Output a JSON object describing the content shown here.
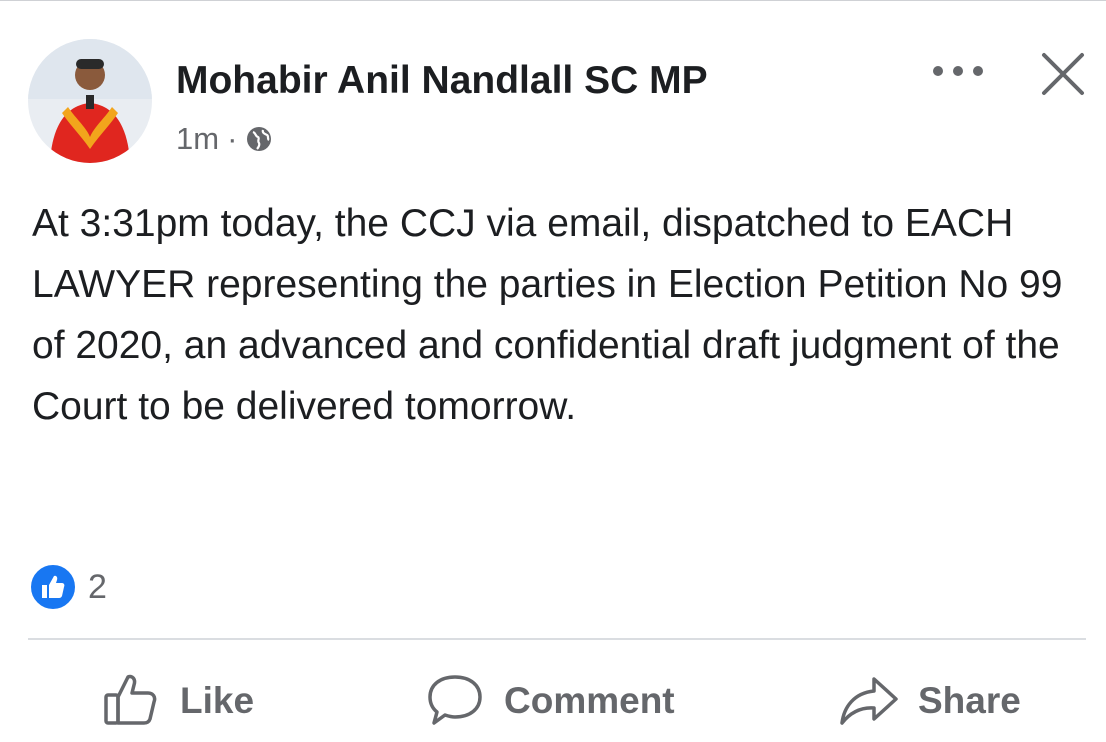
{
  "post": {
    "author": "Mohabir Anil Nandlall SC MP",
    "time": "1m",
    "separator": "·",
    "audience_icon": "globe-icon",
    "text": "At 3:31pm today, the CCJ via email, dispatched to EACH LAWYER representing the parties in Election Petition No 99 of 2020, an advanced and confidential draft judgment of the Court to be delivered tomorrow.",
    "reactions": {
      "icon": "like-reaction-icon",
      "count": "2"
    }
  },
  "actions": {
    "like_label": "Like",
    "comment_label": "Comment",
    "share_label": "Share"
  },
  "colors": {
    "text": "#1c1e21",
    "secondary": "#65676b",
    "like_blue": "#1877f2",
    "divider": "#dadde1"
  }
}
